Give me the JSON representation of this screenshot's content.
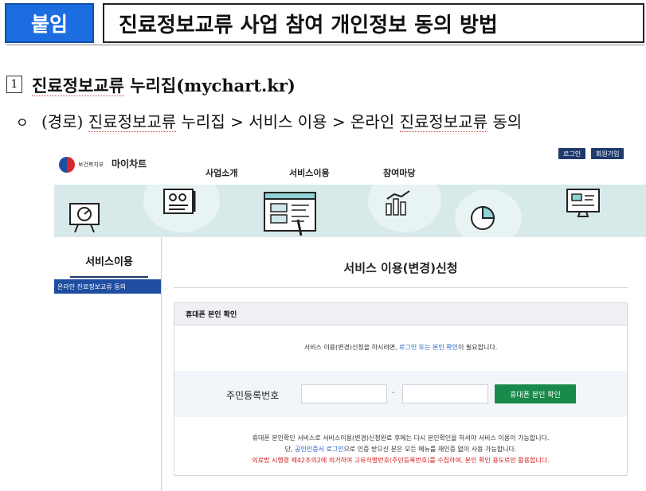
{
  "header": {
    "badge": "붙임",
    "title": "진료정보교류 사업 참여 개인정보 동의 방법"
  },
  "section": {
    "number": "1",
    "title_underlined": "진료정보교류",
    "title_rest": " 누리집(mychart.kr)"
  },
  "route": {
    "bullet": "ㅇ",
    "prefix": "(경로) ",
    "part1": "진료정보교류",
    "part2": " 누리집 > 서비스 이용 > 온라인 ",
    "part3": "진료정보교류",
    "part4": " 동의"
  },
  "site": {
    "ministry": "보건복지부",
    "name": "마이차트",
    "nav": [
      "사업소개",
      "서비스이용",
      "참여마당"
    ],
    "login": "로그인",
    "signup": "회원가입",
    "sidebar_title": "서비스이용",
    "sidebar_item": "온라인 진료정보교류 동의",
    "page_title": "서비스 이용(변경)신청",
    "panel_heading": "휴대폰 본인 확인",
    "notice_pre": "서비스 이용(변경)신청을 하시려면, ",
    "notice_link": "로그인 또는 본인 확인",
    "notice_post": "이 필요합니다.",
    "id_label": "주민등록번호",
    "id_dash": "-",
    "verify_button": "휴대폰 본인 확인",
    "foot1": "휴대폰 본인확인 서비스로 서비스이용(변경)신청완료 후에는 다시 본인확인을 하셔야 서비스 이용이 가능합니다.",
    "foot2_pre": "단, ",
    "foot2_link1": "공인인증서 로그인",
    "foot2_post": "으로 인증 받으신 분은 모든 메뉴를 재인증 없이 사용 가능합니다.",
    "foot3": "의료법 시행령 제42조의2에 의거하여 고유식별번호(주민등록번호)를 수집하며, 본인 확인 용도로만 활용합니다."
  },
  "icons": [
    "emblem-icon",
    "presentation-icon",
    "document-icon",
    "browser-window-icon",
    "bar-chart-icon",
    "pie-chart-icon",
    "monitor-icon"
  ]
}
